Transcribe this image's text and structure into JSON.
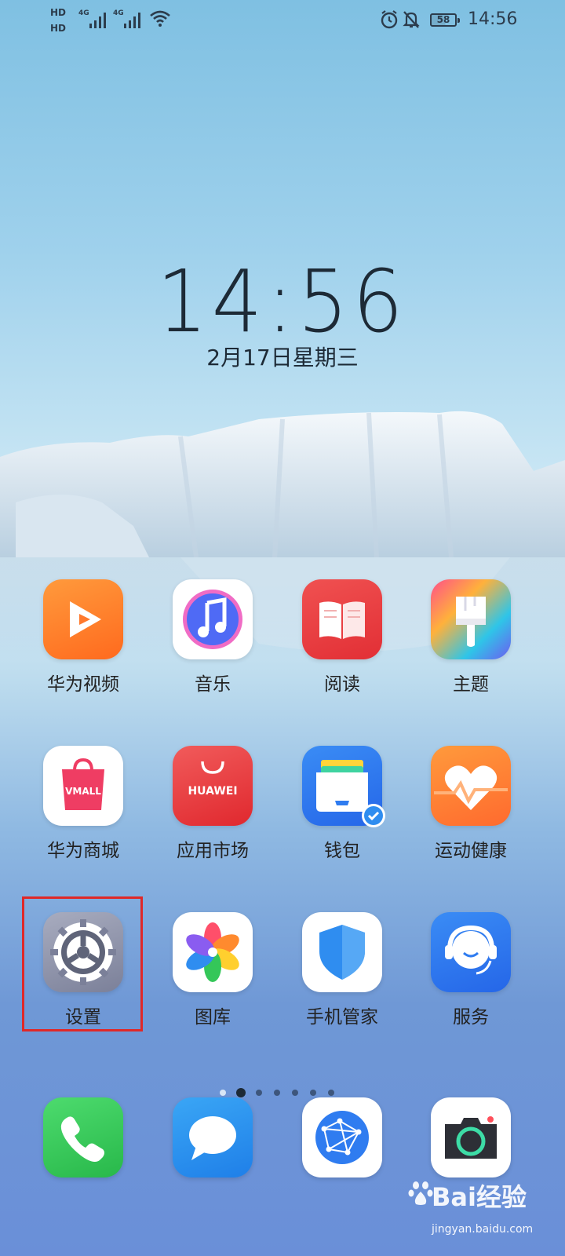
{
  "status_bar": {
    "hd1": "HD",
    "hd2": "HD",
    "sim1_net": "4G",
    "sim2_net": "4G",
    "battery": "58",
    "time": "14:56",
    "icons": [
      "hd-icon",
      "signal-icon",
      "wifi-icon",
      "alarm-icon",
      "mute-icon",
      "battery-icon"
    ]
  },
  "lockclock": {
    "time": "14:56",
    "date": "2月17日星期三"
  },
  "apps": {
    "row1": [
      {
        "label": "华为视频",
        "icon": "huawei-video-icon",
        "color": "#ff7a2e"
      },
      {
        "label": "音乐",
        "icon": "music-icon",
        "color": "#4a66f2"
      },
      {
        "label": "阅读",
        "icon": "reading-icon",
        "color": "#e8383a"
      },
      {
        "label": "主题",
        "icon": "themes-icon",
        "color": "#6d5cf0"
      }
    ],
    "row2": [
      {
        "label": "华为商城",
        "icon": "vmall-icon",
        "color": "#e8385a",
        "text": "VMALL"
      },
      {
        "label": "应用市场",
        "icon": "appgallery-icon",
        "color": "#e8383a",
        "text": "HUAWEI"
      },
      {
        "label": "钱包",
        "icon": "wallet-icon",
        "color": "#2f7cf0"
      },
      {
        "label": "运动健康",
        "icon": "health-icon",
        "color": "#ff7a2e"
      }
    ],
    "row3": [
      {
        "label": "设置",
        "icon": "settings-icon",
        "color": "#8e93a8"
      },
      {
        "label": "图库",
        "icon": "gallery-icon",
        "color": "#ffffff"
      },
      {
        "label": "手机管家",
        "icon": "phone-manager-icon",
        "color": "#2f8df0"
      },
      {
        "label": "服务",
        "icon": "service-icon",
        "color": "#2f7cf0"
      }
    ]
  },
  "dock": [
    {
      "icon": "phone-icon",
      "color": "#34c759"
    },
    {
      "icon": "messages-icon",
      "color": "#2f8df0"
    },
    {
      "icon": "browser-icon",
      "color": "#2f7cf0"
    },
    {
      "icon": "camera-icon",
      "color": "#2d2f36"
    }
  ],
  "page_indicator": {
    "pages": 6,
    "current": 1
  },
  "watermark": {
    "brand": "Bai经验",
    "url": "jingyan.baidu.com"
  }
}
